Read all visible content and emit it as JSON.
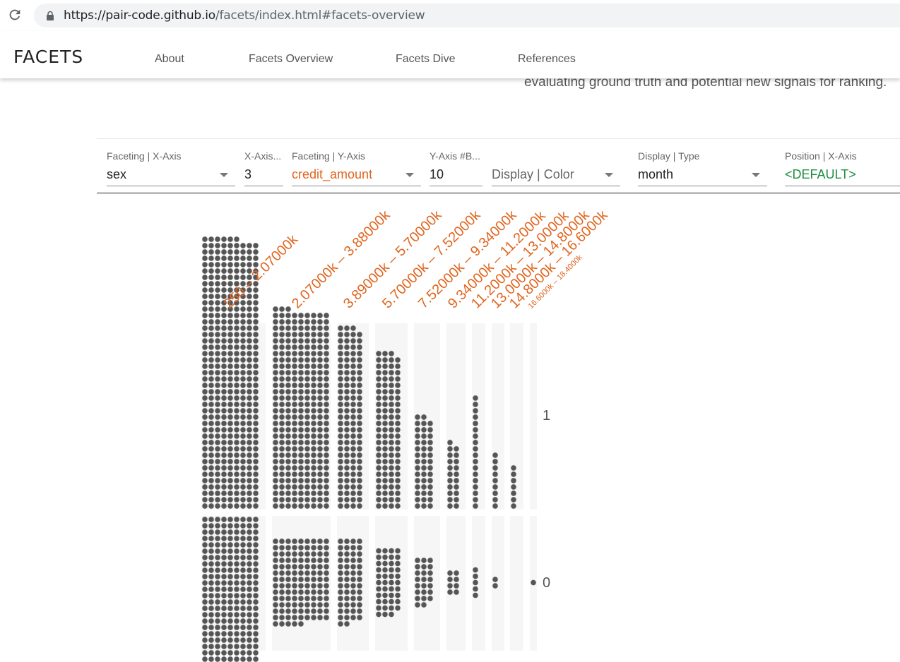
{
  "browser": {
    "url_host": "https://pair-code.github.io",
    "url_path": "/facets/index.html#facets-overview"
  },
  "site": {
    "brand": "FACETS",
    "nav": [
      "About",
      "Facets Overview",
      "Facets Dive",
      "References"
    ],
    "intro_text": "evaluating ground truth and potential new signals for ranking."
  },
  "controls": [
    {
      "label": "Faceting | X-Axis",
      "value": "sex",
      "value_color": "#222222"
    },
    {
      "label": "X-Axis...",
      "value": "3",
      "value_color": "#222222"
    },
    {
      "label": "Faceting | Y-Axis",
      "value": "credit_amount",
      "value_color": "#e0651f"
    },
    {
      "label": "Y-Axis #B...",
      "value": "10",
      "value_color": "#222222"
    },
    {
      "label": "",
      "value": "Display | Color",
      "value_color": "#666666"
    },
    {
      "label": "Display | Type",
      "value": "month",
      "value_color": "#222222"
    },
    {
      "label": "Position | X-Axis",
      "value": "<DEFAULT>",
      "value_color": "#1e8e3e"
    }
  ],
  "colors": {
    "accent_orange": "#e0651f",
    "accent_green": "#1e8e3e",
    "dot_fill": "#555555",
    "column_bg": "#f6f6f6"
  },
  "chart_data": {
    "type": "scatter",
    "x_facet": "credit_amount",
    "y_facet": "sex",
    "categories": [
      "250 – 2.07000k",
      "2.07000k – 3.88000k",
      "3.89000k – 5.70000k",
      "5.70000k – 7.52000k",
      "7.52000k – 9.34000k",
      "9.34000k – 11.2000k",
      "11.2000k – 13.0000k",
      "13.0000k – 14.8000k",
      "14.8000k – 16.6000k",
      "16.6000k – 18.4000k"
    ],
    "row_labels": [
      "1",
      "0"
    ],
    "series": [
      {
        "name": "1",
        "values": [
          384,
          282,
          115,
          99,
          44,
          21,
          18,
          9,
          7,
          0
        ]
      },
      {
        "name": "0",
        "values": [
          237,
          122,
          54,
          43,
          23,
          8,
          5,
          2,
          0,
          1
        ]
      }
    ]
  }
}
